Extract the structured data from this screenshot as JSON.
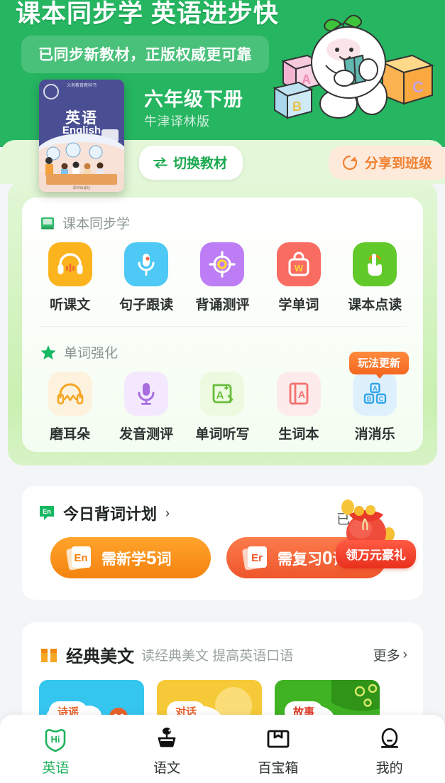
{
  "header": {
    "hero_title": "课本同步学 英语进步快",
    "hero_subtitle": "已同步新教材，正版权威更可靠",
    "grade": "六年级下册",
    "press": "牛津译林版",
    "switch_label": "切换教材",
    "share_label": "分享到班级",
    "book_cover": {
      "cn_title": "英语",
      "en_title": "English",
      "top_line": "义务教育教科书",
      "publisher": "译林出版社"
    },
    "mascot_blocks": [
      "A",
      "B",
      "C"
    ],
    "brand_green": "#26b561"
  },
  "sync_section": {
    "title": "课本同步学",
    "icon": "book-icon",
    "items": [
      {
        "label": "听课文",
        "icon": "headphones-icon",
        "bg": "#fcb41e",
        "fg": "#ffffff"
      },
      {
        "label": "句子跟读",
        "icon": "microphone-icon",
        "bg": "#4ec8f4",
        "fg": "#ffffff"
      },
      {
        "label": "背诵测评",
        "icon": "target-icon",
        "bg": "#bd7ef5",
        "fg": "#ffffff"
      },
      {
        "label": "学单词",
        "icon": "wordbag-icon",
        "bg": "#f96c62",
        "fg": "#ffffff"
      },
      {
        "label": "课本点读",
        "icon": "tap-hand-icon",
        "bg": "#62c92b",
        "fg": "#ffffff"
      }
    ]
  },
  "word_section": {
    "title": "单词强化",
    "icon": "star-icon",
    "badge": "玩法更新",
    "items": [
      {
        "label": "磨耳朵",
        "icon": "headphones-wave-icon",
        "bg": "#fdf2dd",
        "fg": "#f5a623"
      },
      {
        "label": "发音测评",
        "icon": "microphone-icon",
        "bg": "#f3e8fd",
        "fg": "#a86ee0"
      },
      {
        "label": "单词听写",
        "icon": "a-plus-note-icon",
        "bg": "#edfae0",
        "fg": "#68bd3c"
      },
      {
        "label": "生词本",
        "icon": "notebook-a-icon",
        "bg": "#fdeaea",
        "fg": "#f2726f"
      },
      {
        "label": "消消乐",
        "icon": "abc-blocks-icon",
        "bg": "#dff0fd",
        "fg": "#30a5e8"
      }
    ]
  },
  "plan_card": {
    "title": "今日背词计划",
    "chevron": "›",
    "icon": "en-tag-icon",
    "done_label": "已背",
    "gift_badge": "领万元豪礼",
    "buttons": [
      {
        "prefix": "需新学",
        "count": "5",
        "suffix": "词",
        "icon": "en-card-icon",
        "color": "#f58310"
      },
      {
        "prefix": "需复习",
        "count": "0",
        "suffix": "词",
        "icon": "en-card-icon",
        "color": "#f0562c"
      }
    ]
  },
  "essay_card": {
    "title": "经典美文",
    "subtitle": "读经典美文 提高英语口语",
    "more_label": "更多",
    "more_chevron": "›",
    "icon": "open-book-icon",
    "thumbs": [
      {
        "label": "诗谣",
        "bg": "#35c6f0",
        "text_color": "#e8622a"
      },
      {
        "label": "对话",
        "bg": "#f6c938",
        "text_color": "#e8622a"
      },
      {
        "label": "故事",
        "bg": "#3fb323",
        "text_color": "#e03a28"
      }
    ]
  },
  "tabbar": {
    "items": [
      {
        "label": "英语",
        "icon": "hi-shield-icon",
        "active": true
      },
      {
        "label": "语文",
        "icon": "desk-lamp-icon",
        "active": false
      },
      {
        "label": "百宝箱",
        "icon": "toolbox-icon",
        "active": false
      },
      {
        "label": "我的",
        "icon": "person-icon",
        "active": false
      }
    ],
    "active_color": "#1fb35c"
  }
}
